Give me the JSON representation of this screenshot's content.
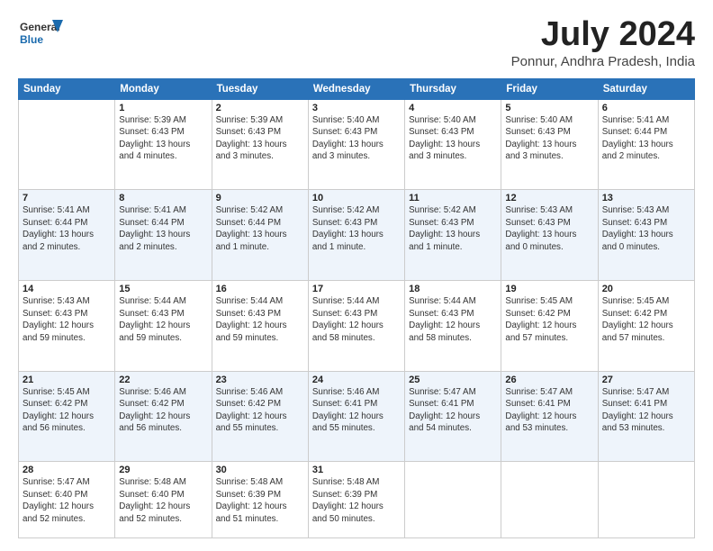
{
  "header": {
    "logo": {
      "general": "General",
      "blue": "Blue"
    },
    "title": "July 2024",
    "location": "Ponnur, Andhra Pradesh, India"
  },
  "calendar": {
    "days_of_week": [
      "Sunday",
      "Monday",
      "Tuesday",
      "Wednesday",
      "Thursday",
      "Friday",
      "Saturday"
    ],
    "weeks": [
      [
        {
          "day": "",
          "info": ""
        },
        {
          "day": "1",
          "info": "Sunrise: 5:39 AM\nSunset: 6:43 PM\nDaylight: 13 hours\nand 4 minutes."
        },
        {
          "day": "2",
          "info": "Sunrise: 5:39 AM\nSunset: 6:43 PM\nDaylight: 13 hours\nand 3 minutes."
        },
        {
          "day": "3",
          "info": "Sunrise: 5:40 AM\nSunset: 6:43 PM\nDaylight: 13 hours\nand 3 minutes."
        },
        {
          "day": "4",
          "info": "Sunrise: 5:40 AM\nSunset: 6:43 PM\nDaylight: 13 hours\nand 3 minutes."
        },
        {
          "day": "5",
          "info": "Sunrise: 5:40 AM\nSunset: 6:43 PM\nDaylight: 13 hours\nand 3 minutes."
        },
        {
          "day": "6",
          "info": "Sunrise: 5:41 AM\nSunset: 6:44 PM\nDaylight: 13 hours\nand 2 minutes."
        }
      ],
      [
        {
          "day": "7",
          "info": "Sunrise: 5:41 AM\nSunset: 6:44 PM\nDaylight: 13 hours\nand 2 minutes."
        },
        {
          "day": "8",
          "info": "Sunrise: 5:41 AM\nSunset: 6:44 PM\nDaylight: 13 hours\nand 2 minutes."
        },
        {
          "day": "9",
          "info": "Sunrise: 5:42 AM\nSunset: 6:44 PM\nDaylight: 13 hours\nand 1 minute."
        },
        {
          "day": "10",
          "info": "Sunrise: 5:42 AM\nSunset: 6:43 PM\nDaylight: 13 hours\nand 1 minute."
        },
        {
          "day": "11",
          "info": "Sunrise: 5:42 AM\nSunset: 6:43 PM\nDaylight: 13 hours\nand 1 minute."
        },
        {
          "day": "12",
          "info": "Sunrise: 5:43 AM\nSunset: 6:43 PM\nDaylight: 13 hours\nand 0 minutes."
        },
        {
          "day": "13",
          "info": "Sunrise: 5:43 AM\nSunset: 6:43 PM\nDaylight: 13 hours\nand 0 minutes."
        }
      ],
      [
        {
          "day": "14",
          "info": "Sunrise: 5:43 AM\nSunset: 6:43 PM\nDaylight: 12 hours\nand 59 minutes."
        },
        {
          "day": "15",
          "info": "Sunrise: 5:44 AM\nSunset: 6:43 PM\nDaylight: 12 hours\nand 59 minutes."
        },
        {
          "day": "16",
          "info": "Sunrise: 5:44 AM\nSunset: 6:43 PM\nDaylight: 12 hours\nand 59 minutes."
        },
        {
          "day": "17",
          "info": "Sunrise: 5:44 AM\nSunset: 6:43 PM\nDaylight: 12 hours\nand 58 minutes."
        },
        {
          "day": "18",
          "info": "Sunrise: 5:44 AM\nSunset: 6:43 PM\nDaylight: 12 hours\nand 58 minutes."
        },
        {
          "day": "19",
          "info": "Sunrise: 5:45 AM\nSunset: 6:42 PM\nDaylight: 12 hours\nand 57 minutes."
        },
        {
          "day": "20",
          "info": "Sunrise: 5:45 AM\nSunset: 6:42 PM\nDaylight: 12 hours\nand 57 minutes."
        }
      ],
      [
        {
          "day": "21",
          "info": "Sunrise: 5:45 AM\nSunset: 6:42 PM\nDaylight: 12 hours\nand 56 minutes."
        },
        {
          "day": "22",
          "info": "Sunrise: 5:46 AM\nSunset: 6:42 PM\nDaylight: 12 hours\nand 56 minutes."
        },
        {
          "day": "23",
          "info": "Sunrise: 5:46 AM\nSunset: 6:42 PM\nDaylight: 12 hours\nand 55 minutes."
        },
        {
          "day": "24",
          "info": "Sunrise: 5:46 AM\nSunset: 6:41 PM\nDaylight: 12 hours\nand 55 minutes."
        },
        {
          "day": "25",
          "info": "Sunrise: 5:47 AM\nSunset: 6:41 PM\nDaylight: 12 hours\nand 54 minutes."
        },
        {
          "day": "26",
          "info": "Sunrise: 5:47 AM\nSunset: 6:41 PM\nDaylight: 12 hours\nand 53 minutes."
        },
        {
          "day": "27",
          "info": "Sunrise: 5:47 AM\nSunset: 6:41 PM\nDaylight: 12 hours\nand 53 minutes."
        }
      ],
      [
        {
          "day": "28",
          "info": "Sunrise: 5:47 AM\nSunset: 6:40 PM\nDaylight: 12 hours\nand 52 minutes."
        },
        {
          "day": "29",
          "info": "Sunrise: 5:48 AM\nSunset: 6:40 PM\nDaylight: 12 hours\nand 52 minutes."
        },
        {
          "day": "30",
          "info": "Sunrise: 5:48 AM\nSunset: 6:39 PM\nDaylight: 12 hours\nand 51 minutes."
        },
        {
          "day": "31",
          "info": "Sunrise: 5:48 AM\nSunset: 6:39 PM\nDaylight: 12 hours\nand 50 minutes."
        },
        {
          "day": "",
          "info": ""
        },
        {
          "day": "",
          "info": ""
        },
        {
          "day": "",
          "info": ""
        }
      ]
    ]
  }
}
